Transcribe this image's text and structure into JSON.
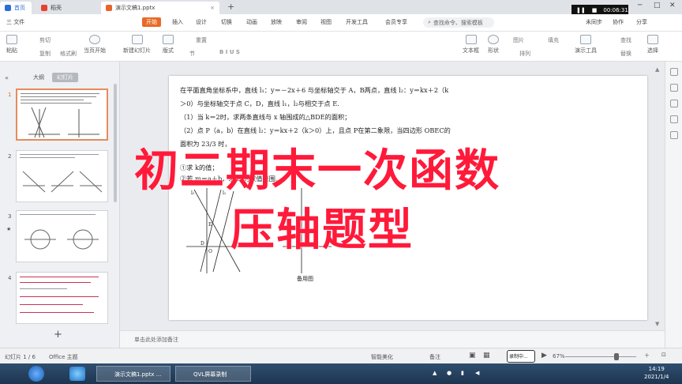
{
  "titlebar": {
    "tab_home": "首页",
    "tab_docer": "稻壳",
    "tab_file": "演示文稿1.pptx",
    "recorder_time": "00:06:31"
  },
  "menubar": {
    "file_menu": "三 文件",
    "start": "开始",
    "items": [
      "插入",
      "设计",
      "切换",
      "动画",
      "放映",
      "审阅",
      "视图",
      "开发工具",
      "会员专享"
    ],
    "search_placeholder": "查找命令、搜索模板",
    "unsync": "未同步",
    "collab": "协作",
    "share": "分享"
  },
  "ribbon": {
    "buttons": [
      "粘贴",
      "剪切",
      "复制",
      "格式刷",
      "当页开始",
      "新建幻灯片",
      "版式",
      "节",
      "重置",
      "文本框",
      "形状",
      "排列",
      "演示工具",
      "替换",
      "选择"
    ],
    "small": [
      "图片",
      "填充",
      "查找"
    ]
  },
  "left_panel": {
    "tab_outline": "大纲",
    "tab_slides": "幻灯片",
    "slide_numbers": [
      "1",
      "2",
      "3",
      "4"
    ],
    "add_button": "+"
  },
  "slide": {
    "lines": [
      "在平面直角坐标系中，直线 l₁：y＝－2x＋6 与坐标轴交于 A，B两点，直线 l₂：y＝kx＋2（k",
      "＞0）与坐标轴交于点 C，D，直线 l₁，l₂与相交于点 E.",
      "（1）当 k＝2时，求两条直线与 x 轴围成的△BDE的面积；",
      "（2）点 P（a，b）在直线 l₂：y＝kx＋2（k＞0）上，且点 P在第二象限，当四边形 OBEC的",
      "面积为 23/3 时，",
      "①求 k的值；",
      "②若 m＝a＋b，求 m的取值范围."
    ],
    "figure_caption": "备用图",
    "overlay_line1": "初二期末一次函数",
    "overlay_line2": "压轴题型"
  },
  "notes_placeholder": "单击此处添加备注",
  "statusbar": {
    "slide_info": "幻灯片 1 / 6",
    "theme": "Office 主题",
    "smart_beautify": "智能美化",
    "notes": "备注",
    "recording": "录制中...",
    "zoom": "67%"
  },
  "taskbar": {
    "task1": "演示文稿1.pptx ...",
    "task2": "QVL屏幕录制",
    "time": "14:19",
    "date": "2021/1/4"
  }
}
